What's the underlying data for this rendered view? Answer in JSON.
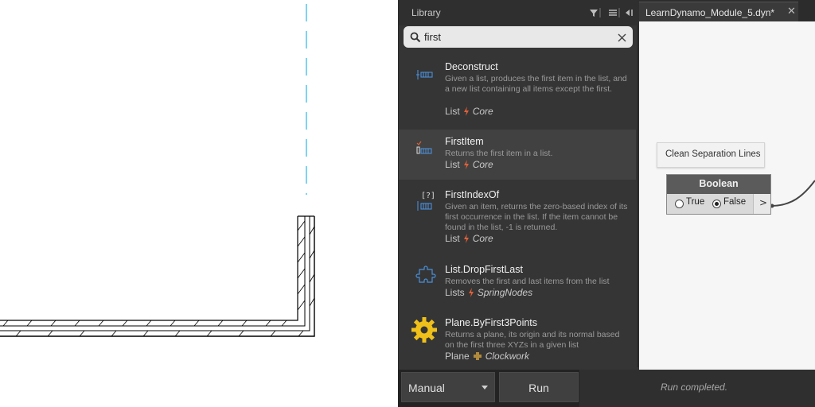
{
  "library": {
    "title": "Library",
    "search": {
      "value": "first",
      "placeholder": ""
    },
    "results": [
      {
        "name": "Deconstruct",
        "description": "Given a list, produces the first item in the list, and a new list containing all items except the first.",
        "category": "List",
        "library": "Core",
        "icon": "list-deconstruct-icon"
      },
      {
        "name": "FirstItem",
        "description": "Returns the first item in a list.",
        "category": "List",
        "library": "Core",
        "icon": "list-first-item-icon",
        "selected": true
      },
      {
        "name": "FirstIndexOf",
        "description": "Given an item, returns the zero-based index of its first occurrence in the list. If the item cannot be found in the list, -1 is returned.",
        "category": "List",
        "library": "Core",
        "icon": "list-index-of-icon"
      },
      {
        "name": "List.DropFirstLast",
        "description": "Removes the first and last items from the list",
        "category": "Lists",
        "library": "SpringNodes",
        "icon": "custom-node-icon"
      },
      {
        "name": "Plane.ByFirst3Points",
        "description": "Returns a plane, its origin and its normal based on the first three XYZs in a given list",
        "category": "Plane",
        "library": "Clockwork",
        "icon": "gear-icon"
      }
    ]
  },
  "workspace": {
    "tab_label": "LearnDynamo_Module_5.dyn*",
    "note": "Clean Separation Lines",
    "node": {
      "title": "Boolean",
      "option_true": "True",
      "option_false": "False",
      "selected": "False",
      "output_port": ">"
    }
  },
  "runbar": {
    "mode": "Manual",
    "run_label": "Run",
    "status": "Run completed."
  },
  "colors": {
    "library_bg": "#353535",
    "canvas_bg": "#f6f6f6",
    "drafting_line": "#29b6e6",
    "bolt": "#e0603a",
    "gear": "#f0c01a"
  }
}
